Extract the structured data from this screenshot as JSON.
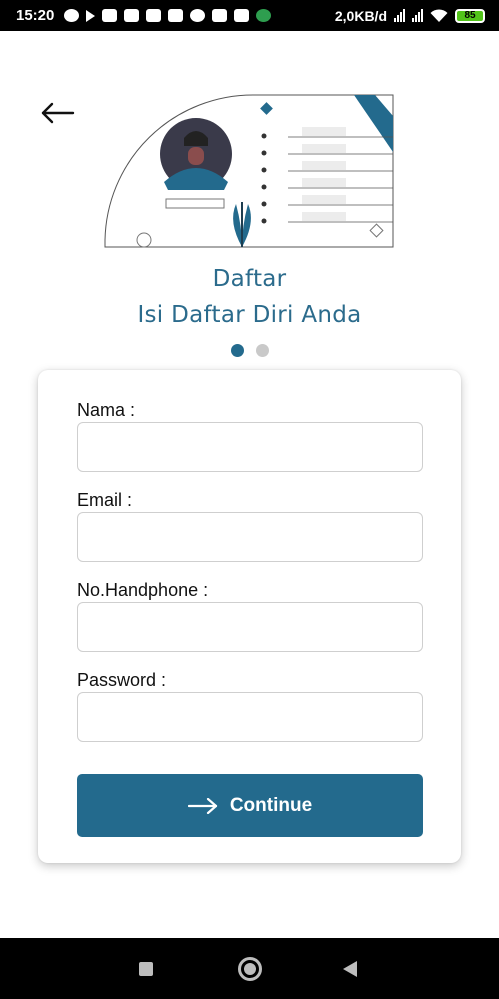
{
  "status_bar": {
    "time": "15:20",
    "network_speed": "2,0KB/d",
    "battery": "85",
    "icons": [
      "chat-icon",
      "play-icon",
      "youtube-icon",
      "tiktok-icon",
      "twitter-icon",
      "calendar-icon",
      "check-icon",
      "bird-icon",
      "bird-icon",
      "vpn-icon"
    ]
  },
  "header": {
    "back_icon": "arrow-left-icon",
    "title": "Daftar",
    "subtitle": "Isi Daftar Diri Anda"
  },
  "pager": {
    "total": 2,
    "active": 1
  },
  "form": {
    "fields": [
      {
        "label": "Nama :",
        "value": "",
        "placeholder": ""
      },
      {
        "label": "Email :",
        "value": "",
        "placeholder": ""
      },
      {
        "label": "No.Handphone :",
        "value": "",
        "placeholder": ""
      },
      {
        "label": "Password :",
        "value": "",
        "placeholder": ""
      }
    ],
    "submit_label": "Continue",
    "submit_icon": "arrow-right-icon"
  },
  "colors": {
    "accent": "#236a8d",
    "title_text": "#2b6b8c",
    "inactive_dot": "#c9c9c9"
  },
  "nav_bar": {
    "icons": [
      "recents-square-icon",
      "home-circle-icon",
      "back-triangle-icon"
    ]
  }
}
